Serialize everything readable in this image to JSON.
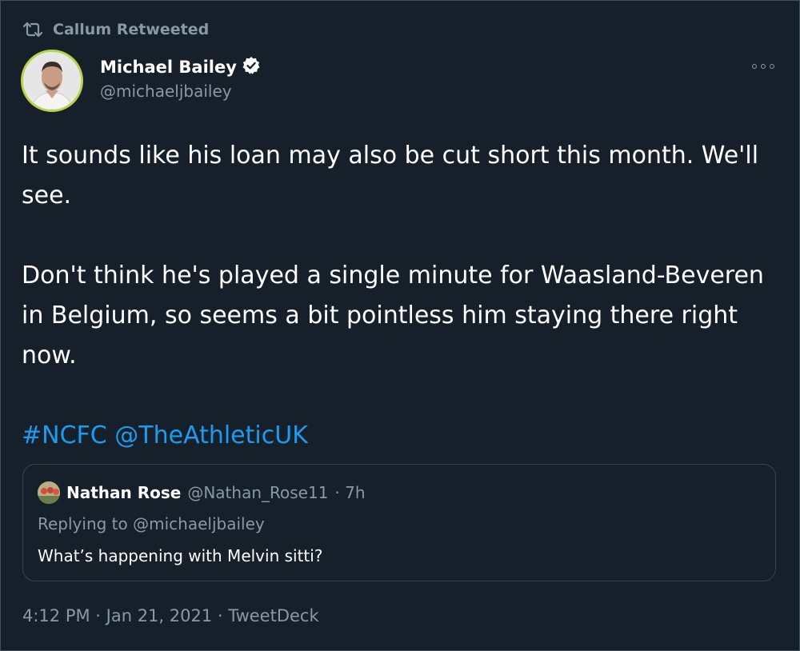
{
  "retweet": {
    "label": "Callum Retweeted",
    "icon": "retweet-icon"
  },
  "author": {
    "name": "Michael Bailey",
    "handle": "@michaeljbailey",
    "verified": true,
    "avatar_border_color": "#b7d34a"
  },
  "tweet": {
    "paragraph_1": "It sounds like his loan may also be cut short this month. We'll see.",
    "paragraph_2": "Don't think he's played a single minute for Waasland-Beveren in Belgium, so seems a bit pointless him staying there right now.",
    "hashtag": "#NCFC",
    "mention": "@TheAthleticUK"
  },
  "quoted": {
    "name": "Nathan Rose",
    "handle": "@Nathan_Rose11",
    "time": "· 7h",
    "replying_prefix": "Replying to",
    "replying_to": "@michaeljbailey",
    "text": "What’s happening with Melvin sitti?"
  },
  "meta": {
    "text": "4:12 PM · Jan 21, 2021 · TweetDeck"
  },
  "colors": {
    "background": "#15202b",
    "secondary_text": "#8899a6",
    "link": "#1d9bf0",
    "border": "#38444d"
  }
}
